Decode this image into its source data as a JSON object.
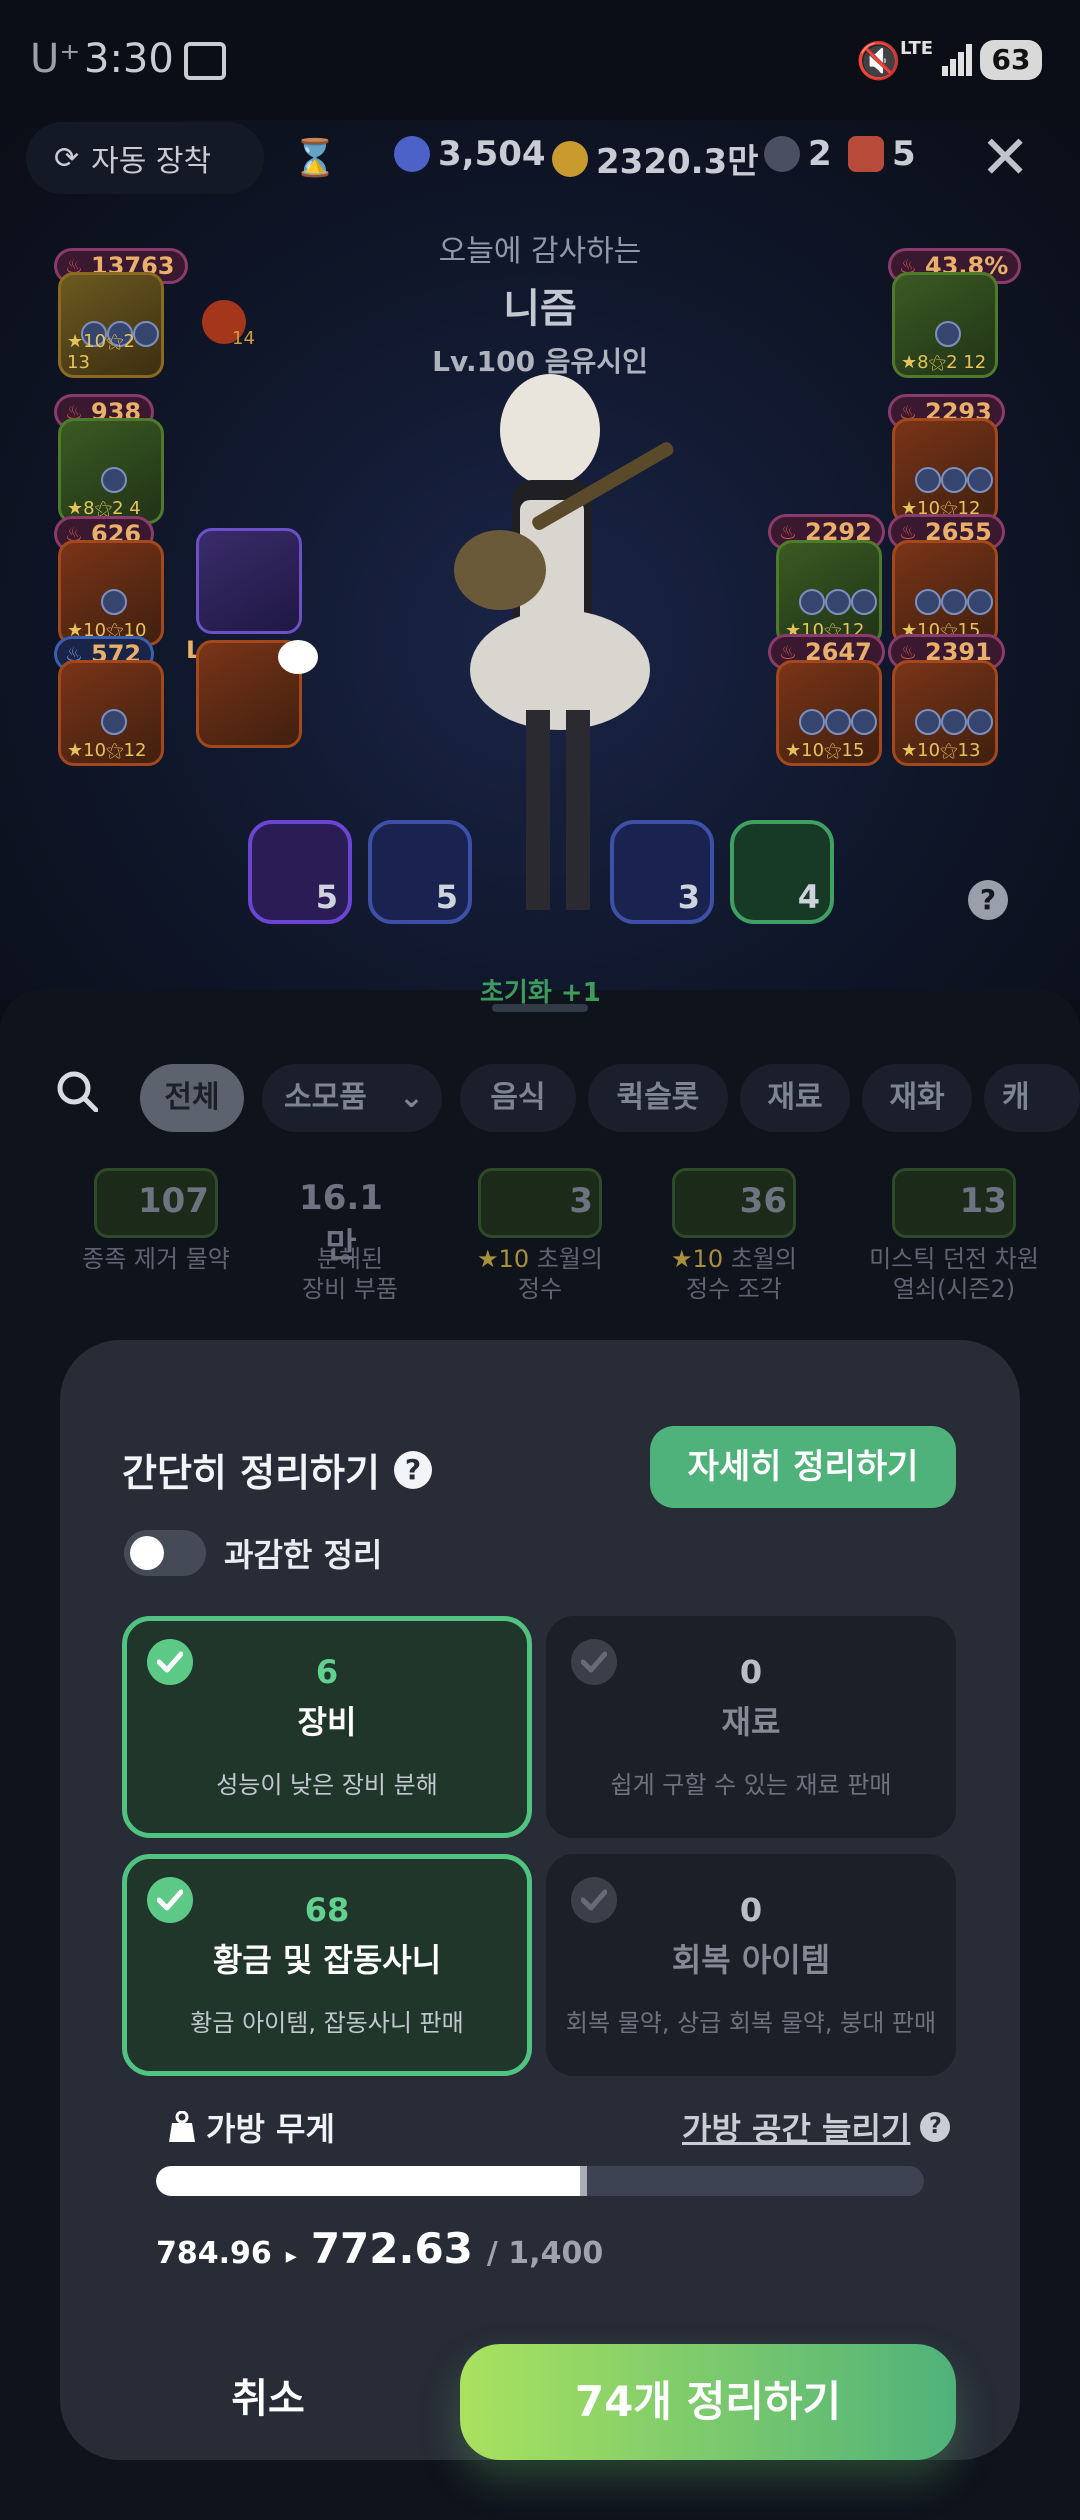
{
  "status": {
    "carrier": "U⁺",
    "time": "3:30",
    "network": "LTE",
    "battery": "63"
  },
  "topbar": {
    "auto_equip_label": "자동 장착",
    "currencies": [
      {
        "icon": "blue-gem-icon",
        "value": "3,504",
        "color": "#4c62c9"
      },
      {
        "icon": "gold-coin-icon",
        "value": "2320.3만",
        "color": "#c99a2e"
      },
      {
        "icon": "dark-orb-icon",
        "value": "2",
        "color": "#4a4f62"
      },
      {
        "icon": "demon-mask-icon",
        "value": "5",
        "color": "#b84a3a"
      }
    ]
  },
  "character": {
    "subtitle": "오늘에 감사하는",
    "name": "니즘",
    "level_class": "Lv.100 음유시인"
  },
  "equipment": {
    "left_pills": [
      "13763",
      "938",
      "626",
      "572"
    ],
    "right_pills": [
      "43.8%",
      "2293",
      "2292",
      "2655",
      "2647",
      "2391"
    ],
    "pet_level": "Lv.34",
    "left_stars": [
      "★10⚝2 13",
      "★8⚝2 4",
      "★10⚝10",
      "★10⚝12"
    ],
    "right_stars": [
      "★8⚝2 12",
      "★10⚝12",
      "★10⚝12",
      "★10⚝15",
      "★10⚝15",
      "★10⚝13"
    ],
    "small_badge": "14"
  },
  "consumables": [
    {
      "count": "5",
      "color": "#6b45d1"
    },
    {
      "count": "5",
      "color": "#3e57c9"
    },
    {
      "count": "3",
      "color": "#3e57c9"
    },
    {
      "count": "4",
      "color": "#3fa061"
    }
  ],
  "inventory": {
    "filters": [
      "전체",
      "소모품",
      "음식",
      "퀵슬롯",
      "재료",
      "재화",
      "캐"
    ],
    "active_filter": "전체",
    "partial_label": "초기화 +1",
    "items": [
      {
        "count": "107",
        "label1": "종족 제거 물약",
        "label2": ""
      },
      {
        "count": "16.1만",
        "label1": "분해된",
        "label2": "장비 부품"
      },
      {
        "count": "3",
        "star": "★10",
        "label1": " 초월의",
        "label2": "정수"
      },
      {
        "count": "36",
        "star": "★10",
        "label1": " 초월의",
        "label2": "정수 조각"
      },
      {
        "count": "13",
        "label1": "미스틱 던전 차원",
        "label2": "열쇠(시즌2)"
      }
    ]
  },
  "modal": {
    "title": "간단히 정리하기",
    "detail_button": "자세히 정리하기",
    "toggle_label": "과감한 정리",
    "cards": [
      {
        "count": "6",
        "name": "장비",
        "desc": "성능이 낮은 장비 분해",
        "checked": true
      },
      {
        "count": "0",
        "name": "재료",
        "desc": "쉽게 구할 수 있는 재료 판매",
        "checked": false
      },
      {
        "count": "68",
        "name": "황금 및 잡동사니",
        "desc": "황금 아이템, 잡동사니 판매",
        "checked": true
      },
      {
        "count": "0",
        "name": "회복 아이템",
        "desc": "회복 물약, 상급 회복 물약, 붕대 판매",
        "checked": false
      }
    ],
    "bag_label": "가방 무게",
    "expand_link": "가방 공간 늘리기",
    "weight_before": "784.96",
    "weight_after": "772.63",
    "weight_max": "/ 1,400",
    "weight_fraction_before": 0.5607,
    "weight_fraction_after": 0.5519,
    "cancel_button": "취소",
    "confirm_button": "74개 정리하기"
  }
}
